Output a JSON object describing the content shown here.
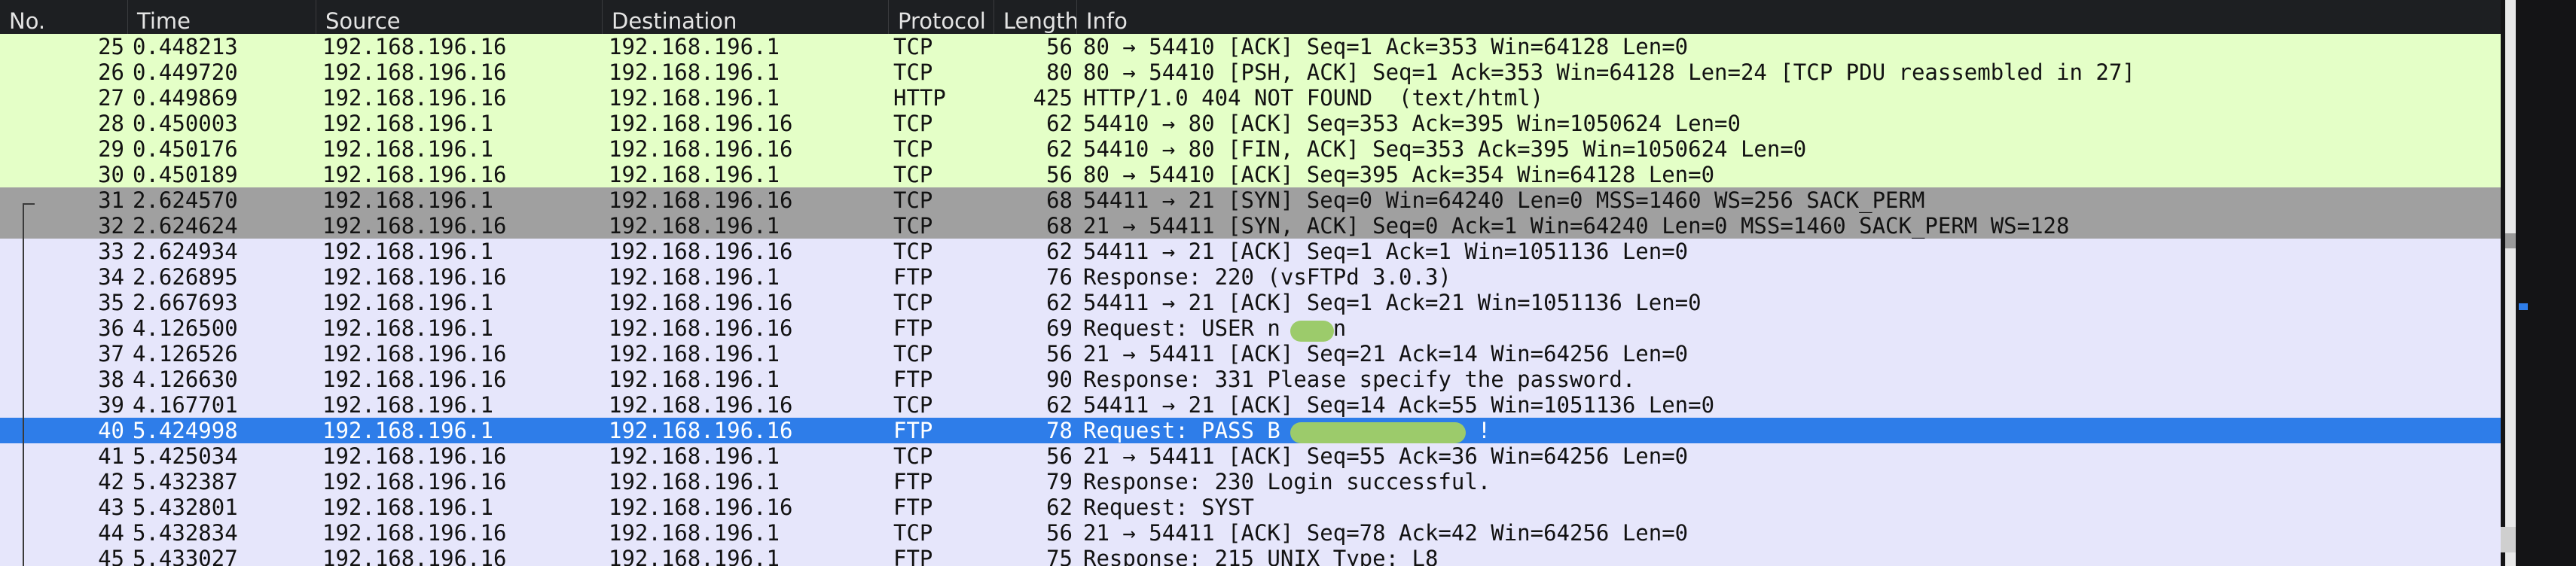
{
  "columns": {
    "no": "No.",
    "time": "Time",
    "source": "Source",
    "destination": "Destination",
    "protocol": "Protocol",
    "length": "Length",
    "info": "Info"
  },
  "packets": [
    {
      "no": "25",
      "time": "0.448213",
      "source": "192.168.196.16",
      "destination": "192.168.196.1",
      "protocol": "TCP",
      "length": "56",
      "info": "80 → 54410 [ACK] Seq=1 Ack=353 Win=64128 Len=0"
    },
    {
      "no": "26",
      "time": "0.449720",
      "source": "192.168.196.16",
      "destination": "192.168.196.1",
      "protocol": "TCP",
      "length": "80",
      "info": "80 → 54410 [PSH, ACK] Seq=1 Ack=353 Win=64128 Len=24 [TCP PDU reassembled in 27]"
    },
    {
      "no": "27",
      "time": "0.449869",
      "source": "192.168.196.16",
      "destination": "192.168.196.1",
      "protocol": "HTTP",
      "length": "425",
      "info": "HTTP/1.0 404 NOT FOUND  (text/html)"
    },
    {
      "no": "28",
      "time": "0.450003",
      "source": "192.168.196.1",
      "destination": "192.168.196.16",
      "protocol": "TCP",
      "length": "62",
      "info": "54410 → 80 [ACK] Seq=353 Ack=395 Win=1050624 Len=0"
    },
    {
      "no": "29",
      "time": "0.450176",
      "source": "192.168.196.1",
      "destination": "192.168.196.16",
      "protocol": "TCP",
      "length": "62",
      "info": "54410 → 80 [FIN, ACK] Seq=353 Ack=395 Win=1050624 Len=0"
    },
    {
      "no": "30",
      "time": "0.450189",
      "source": "192.168.196.16",
      "destination": "192.168.196.1",
      "protocol": "TCP",
      "length": "56",
      "info": "80 → 54410 [ACK] Seq=395 Ack=354 Win=64128 Len=0"
    },
    {
      "no": "31",
      "time": "2.624570",
      "source": "192.168.196.1",
      "destination": "192.168.196.16",
      "protocol": "TCP",
      "length": "68",
      "info": "54411 → 21 [SYN] Seq=0 Win=64240 Len=0 MSS=1460 WS=256 SACK_PERM"
    },
    {
      "no": "32",
      "time": "2.624624",
      "source": "192.168.196.16",
      "destination": "192.168.196.1",
      "protocol": "TCP",
      "length": "68",
      "info": "21 → 54411 [SYN, ACK] Seq=0 Ack=1 Win=64240 Len=0 MSS=1460 SACK_PERM WS=128"
    },
    {
      "no": "33",
      "time": "2.624934",
      "source": "192.168.196.1",
      "destination": "192.168.196.16",
      "protocol": "TCP",
      "length": "62",
      "info": "54411 → 21 [ACK] Seq=1 Ack=1 Win=1051136 Len=0"
    },
    {
      "no": "34",
      "time": "2.626895",
      "source": "192.168.196.16",
      "destination": "192.168.196.1",
      "protocol": "FTP",
      "length": "76",
      "info": "Response: 220 (vsFTPd 3.0.3)"
    },
    {
      "no": "35",
      "time": "2.667693",
      "source": "192.168.196.1",
      "destination": "192.168.196.16",
      "protocol": "TCP",
      "length": "62",
      "info": "54411 → 21 [ACK] Seq=1 Ack=21 Win=1051136 Len=0"
    },
    {
      "no": "36",
      "time": "4.126500",
      "source": "192.168.196.1",
      "destination": "192.168.196.16",
      "protocol": "FTP",
      "length": "69",
      "info": "Request: USER n    n"
    },
    {
      "no": "37",
      "time": "4.126526",
      "source": "192.168.196.16",
      "destination": "192.168.196.1",
      "protocol": "TCP",
      "length": "56",
      "info": "21 → 54411 [ACK] Seq=21 Ack=14 Win=64256 Len=0"
    },
    {
      "no": "38",
      "time": "4.126630",
      "source": "192.168.196.16",
      "destination": "192.168.196.1",
      "protocol": "FTP",
      "length": "90",
      "info": "Response: 331 Please specify the password."
    },
    {
      "no": "39",
      "time": "4.167701",
      "source": "192.168.196.1",
      "destination": "192.168.196.16",
      "protocol": "TCP",
      "length": "62",
      "info": "54411 → 21 [ACK] Seq=14 Ack=55 Win=1051136 Len=0"
    },
    {
      "no": "40",
      "time": "5.424998",
      "source": "192.168.196.1",
      "destination": "192.168.196.16",
      "protocol": "FTP",
      "length": "78",
      "info": "Request: PASS B               !"
    },
    {
      "no": "41",
      "time": "5.425034",
      "source": "192.168.196.16",
      "destination": "192.168.196.1",
      "protocol": "TCP",
      "length": "56",
      "info": "21 → 54411 [ACK] Seq=55 Ack=36 Win=64256 Len=0"
    },
    {
      "no": "42",
      "time": "5.432387",
      "source": "192.168.196.16",
      "destination": "192.168.196.1",
      "protocol": "FTP",
      "length": "79",
      "info": "Response: 230 Login successful."
    },
    {
      "no": "43",
      "time": "5.432801",
      "source": "192.168.196.1",
      "destination": "192.168.196.16",
      "protocol": "FTP",
      "length": "62",
      "info": "Request: SYST"
    },
    {
      "no": "44",
      "time": "5.432834",
      "source": "192.168.196.16",
      "destination": "192.168.196.1",
      "protocol": "TCP",
      "length": "56",
      "info": "21 → 54411 [ACK] Seq=78 Ack=42 Win=64256 Len=0"
    },
    {
      "no": "45",
      "time": "5.433027",
      "source": "192.168.196.16",
      "destination": "192.168.196.1",
      "protocol": "FTP",
      "length": "75",
      "info": "Response: 215 UNIX Type: L8"
    }
  ],
  "colors": {
    "tcp_row": "#e6e6fb",
    "http_row": "#e4ffc7",
    "syn_row": "#a0a0a0",
    "selected_row": "#2e7de9",
    "header_bg": "#1d1f22"
  },
  "selected_packet": "40"
}
